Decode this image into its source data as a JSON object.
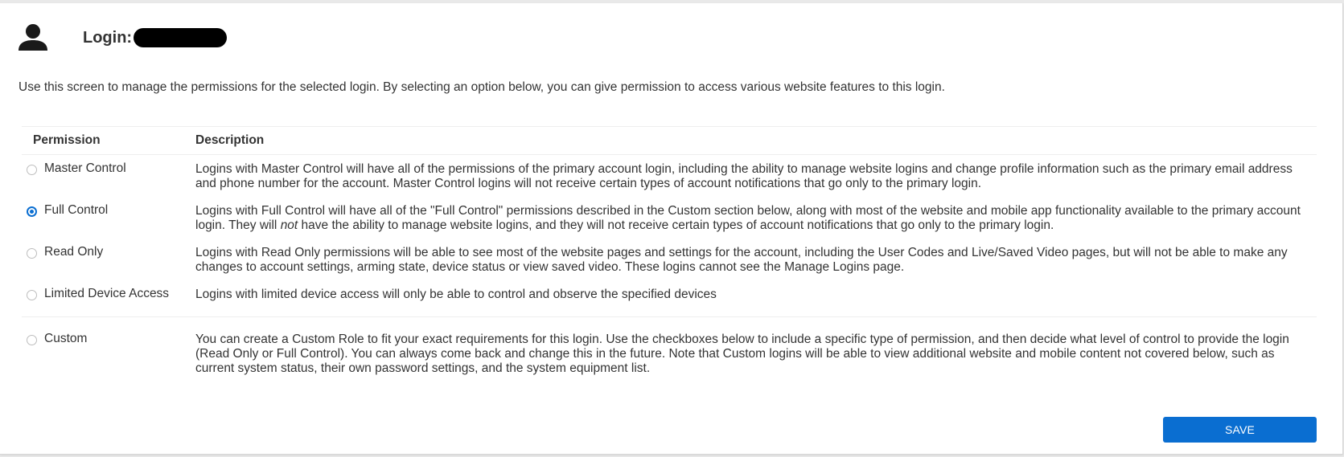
{
  "header": {
    "login_label": "Login:"
  },
  "intro_text": "Use this screen to manage the permissions for the selected login. By selecting an option below, you can give permission to access various website features to this login.",
  "table": {
    "headers": {
      "permission": "Permission",
      "description": "Description"
    },
    "options": [
      {
        "label": "Master Control",
        "selected": false,
        "description": "Logins with Master Control will have all of the permissions of the primary account login, including the ability to manage website logins and change profile information such as the primary email address and phone number for the account. Master Control logins will not receive certain types of account notifications that go only to the primary login."
      },
      {
        "label": "Full Control",
        "selected": true,
        "description_before": "Logins with Full Control will have all of the \"Full Control\" permissions described in the Custom section below, along with most of the website and mobile app functionality available to the primary account login. They will ",
        "description_em": "not",
        "description_after": " have the ability to manage website logins, and they will not receive certain types of account notifications that go only to the primary login."
      },
      {
        "label": "Read Only",
        "selected": false,
        "description": "Logins with Read Only permissions will be able to see most of the website pages and settings for the account, including the User Codes and Live/Saved Video pages, but will not be able to make any changes to account settings, arming state, device status or view saved video. These logins cannot see the Manage Logins page."
      },
      {
        "label": "Limited Device Access",
        "selected": false,
        "description": "Logins with limited device access will only be able to control and observe the specified devices"
      },
      {
        "label": "Custom",
        "selected": false,
        "description": "You can create a Custom Role to fit your exact requirements for this login. Use the checkboxes below to include a specific type of permission, and then decide what level of control to provide the login (Read Only or Full Control). You can always come back and change this in the future. Note that Custom logins will be able to view additional website and mobile content not covered below, such as current system status, their own password settings, and the system equipment list."
      }
    ]
  },
  "save_button": {
    "label": "SAVE"
  },
  "colors": {
    "accent": "#0a6ed1",
    "text": "#333333",
    "divider": "#eeeeee"
  }
}
